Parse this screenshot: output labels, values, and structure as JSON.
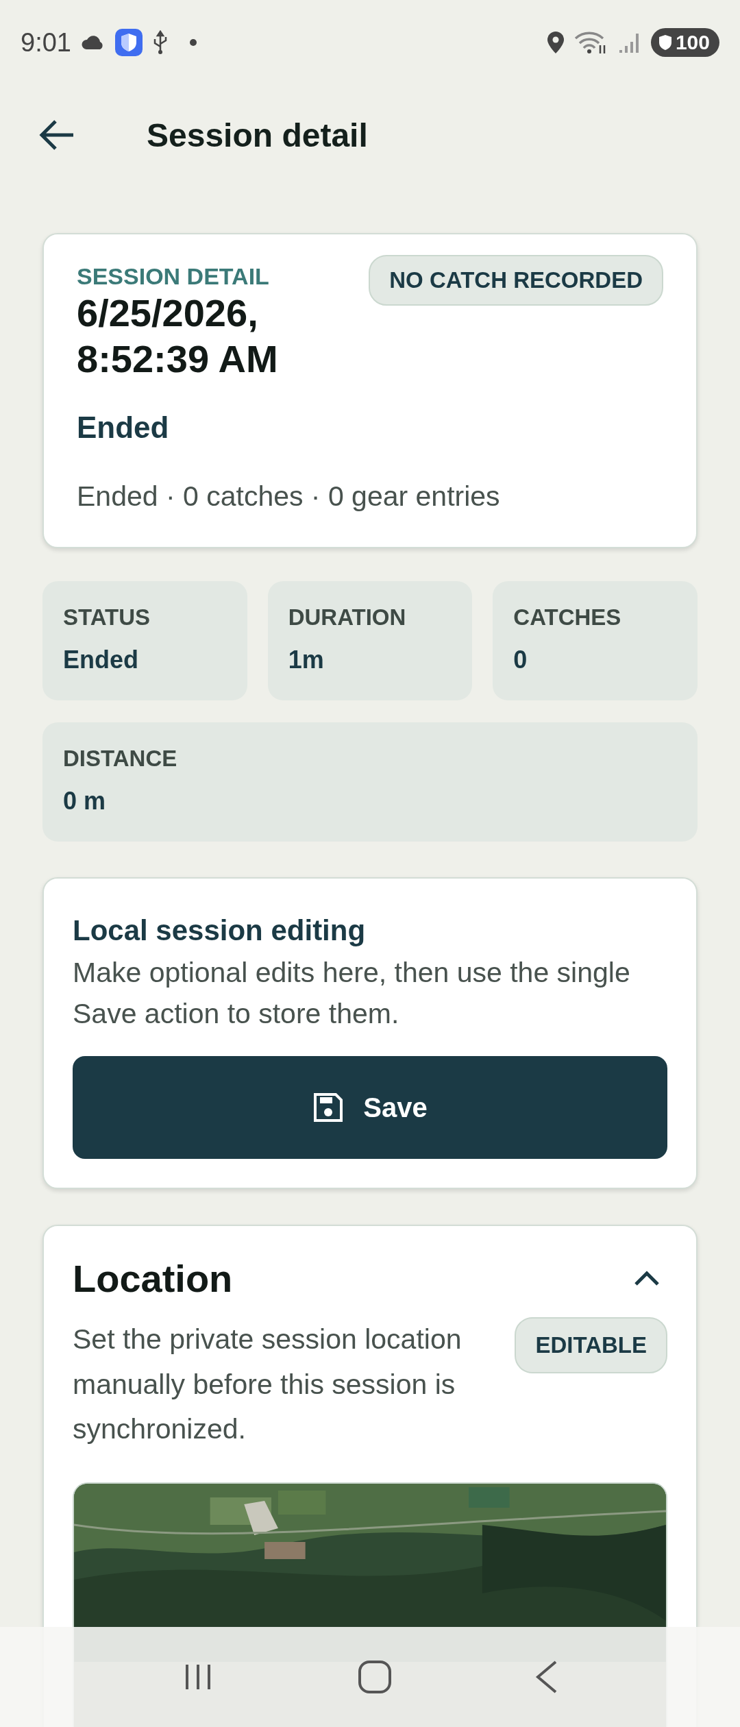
{
  "status_bar": {
    "time": "9:01",
    "battery": "100"
  },
  "app_bar": {
    "title": "Session detail"
  },
  "summary_card": {
    "eyebrow": "SESSION DETAIL",
    "title": "6/25/2026, 8:52:39 AM",
    "badge": "NO CATCH RECORDED",
    "status": "Ended",
    "summary": "Ended · 0 catches · 0 gear entries"
  },
  "stats": [
    {
      "label": "STATUS",
      "value": "Ended"
    },
    {
      "label": "DURATION",
      "value": "1m"
    },
    {
      "label": "CATCHES",
      "value": "0"
    },
    {
      "label": "DISTANCE",
      "value": "0 m"
    }
  ],
  "edit_card": {
    "title": "Local session editing",
    "description": "Make optional edits here, then use the single Save action to store them.",
    "button": "Save"
  },
  "location_card": {
    "title": "Location",
    "expanded": true,
    "description": "Set the private session location manually before this session is synchronized.",
    "badge": "EDITABLE"
  }
}
